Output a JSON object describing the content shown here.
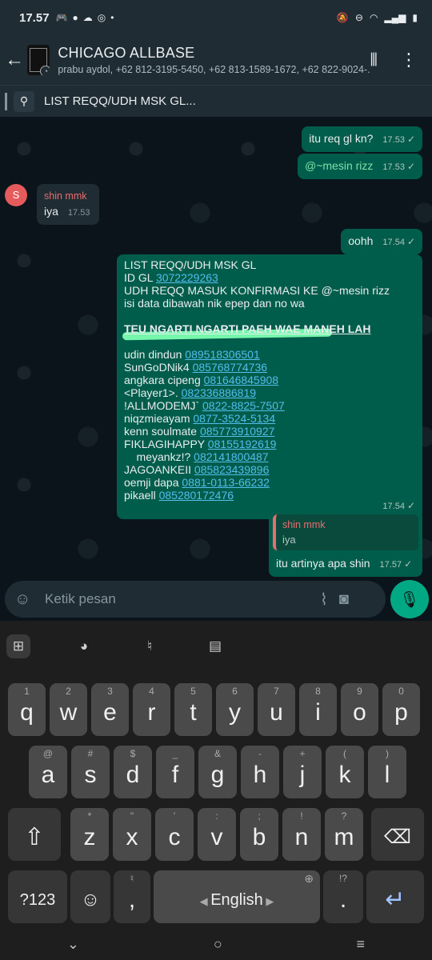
{
  "status_bar": {
    "time": "17.57",
    "left_icons": [
      "game-controller-icon",
      "message-icon",
      "cloud-icon",
      "instagram-icon",
      "dot-icon"
    ],
    "right_icons": [
      "mute-icon",
      "dnd-icon",
      "wifi-icon",
      "signal-icon",
      "battery-icon"
    ]
  },
  "header": {
    "back_icon": "arrow-left-icon",
    "group_name": "CHICAGO ALLBASE",
    "members": "prabu aydol, +62 812-3195-5450, +62 813-1589-1672, +62 822-9024-...",
    "actions": [
      "voice-call-waves-icon",
      "more-vertical-icon"
    ]
  },
  "pinned": {
    "icon": "pin-icon",
    "text": "LIST REQQ/UDH MSK GL..."
  },
  "messages": {
    "m1": {
      "text": "itu req gl kn?",
      "time": "17.53"
    },
    "m2": {
      "mention": "@~mesin rizz",
      "time": "17.53"
    },
    "m3": {
      "sender": "shin mmk",
      "avatar_letter": "S",
      "text": "iya",
      "time": "17.53"
    },
    "m4": {
      "text": "oohh",
      "time": "17.54"
    },
    "m5": {
      "line1": "LIST REQQ/UDH MSK GL",
      "id_label": "ID GL",
      "id_value": "3072229263",
      "line3_pre": "UDH REQQ MASUK KONFIRMASI KE ",
      "line3_mention": "@~mesin rizz",
      "line4": "isi data dibawah nik epep dan no wa",
      "bold_line": "TEU NGARTI NGARTI PAEH WAE MANEH LAH",
      "entries": [
        {
          "name": "udin dindun",
          "phone": "089518306501"
        },
        {
          "name": "SunGoDNik4",
          "phone": "085768774736"
        },
        {
          "name": "angkara cipeng",
          "phone": "081646845908"
        },
        {
          "name": "<Player1>.",
          "phone": "082336886819"
        },
        {
          "name": "!ALLMODEMJ`",
          "phone": "0822-8825-7507"
        },
        {
          "name": "niqzmieayam",
          "phone": "0877-3524-5134"
        },
        {
          "name": "kenn soulmate",
          "phone": "085773910927"
        },
        {
          "name": "FIKLAGIHAPPY",
          "phone": "08155192619"
        },
        {
          "name": "    meyankz!?",
          "phone": "082141800487"
        },
        {
          "name": "JAGOANKEII",
          "phone": "085823439896"
        },
        {
          "name": "oemji dapa",
          "phone": "0881-0113-66232"
        },
        {
          "name": "pikaell",
          "phone": "085280172476"
        }
      ],
      "time": "17.54"
    },
    "m6": {
      "quote_name": "shin mmk",
      "quote_text": "iya",
      "text": "itu artinya apa shin",
      "time": "17.57"
    }
  },
  "composer": {
    "placeholder": "Ketik pesan",
    "icons": [
      "emoji-sticker-icon",
      "paperclip-icon",
      "camera-icon",
      "microphone-icon"
    ]
  },
  "keyboard": {
    "toolbar": [
      "apps-grid-icon",
      "palette-icon",
      "microphone-icon",
      "clipboard-icon"
    ],
    "row1": [
      {
        "k": "q",
        "s": "1"
      },
      {
        "k": "w",
        "s": "2"
      },
      {
        "k": "e",
        "s": "3"
      },
      {
        "k": "r",
        "s": "4"
      },
      {
        "k": "t",
        "s": "5"
      },
      {
        "k": "y",
        "s": "6"
      },
      {
        "k": "u",
        "s": "7"
      },
      {
        "k": "i",
        "s": "8"
      },
      {
        "k": "o",
        "s": "9"
      },
      {
        "k": "p",
        "s": "0"
      }
    ],
    "row2": [
      {
        "k": "a",
        "s": "@"
      },
      {
        "k": "s",
        "s": "#"
      },
      {
        "k": "d",
        "s": "$"
      },
      {
        "k": "f",
        "s": "_"
      },
      {
        "k": "g",
        "s": "&"
      },
      {
        "k": "h",
        "s": "-"
      },
      {
        "k": "j",
        "s": "+"
      },
      {
        "k": "k",
        "s": "("
      },
      {
        "k": "l",
        "s": ")"
      }
    ],
    "row3": [
      {
        "k": "z",
        "s": "*"
      },
      {
        "k": "x",
        "s": "\""
      },
      {
        "k": "c",
        "s": "'"
      },
      {
        "k": "v",
        "s": ":"
      },
      {
        "k": "b",
        "s": ";"
      },
      {
        "k": "n",
        "s": "!"
      },
      {
        "k": "m",
        "s": "?"
      }
    ],
    "symbols_label": "?123",
    "comma": ",",
    "space_label": "English",
    "period": ".",
    "period_sup": "!?"
  },
  "nav": [
    "chevron-down-icon",
    "home-circle-icon",
    "recents-lines-icon"
  ]
}
